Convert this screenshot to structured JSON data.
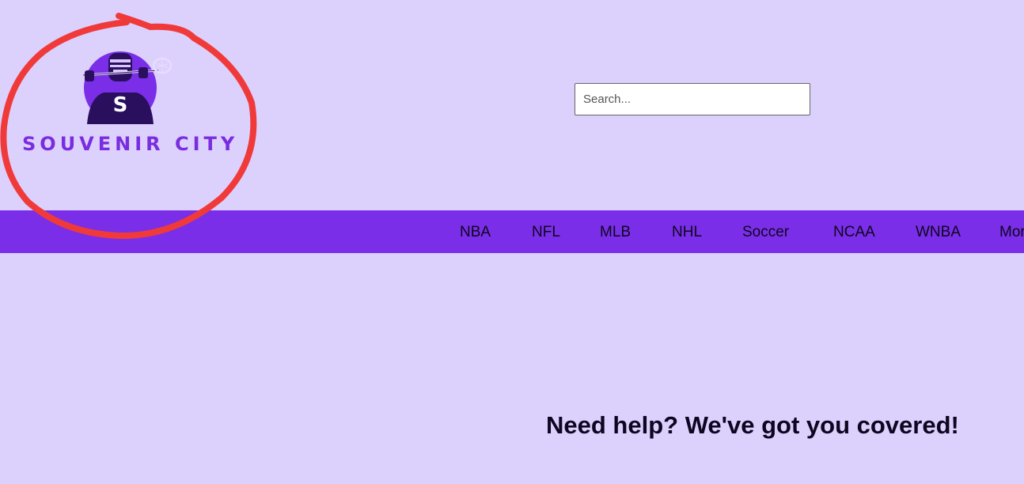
{
  "brand": {
    "logo_text": "SOUVENIR CITY",
    "logo_initial": "S",
    "accent_color": "#7a2ee8",
    "background_color": "#dcd0fd",
    "annotation_color": "#f03a3a"
  },
  "search": {
    "placeholder": "Search..."
  },
  "nav": {
    "items": [
      "NBA",
      "NFL",
      "MLB",
      "NHL",
      "Soccer",
      "NCAA",
      "WNBA",
      "More"
    ]
  },
  "main": {
    "heading": "Need help? We've got you covered!"
  },
  "icons": {
    "logo": "lacrosse-player-logo-icon"
  }
}
